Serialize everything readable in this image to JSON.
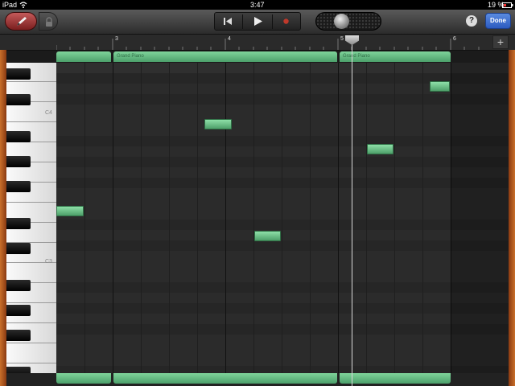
{
  "status_bar": {
    "device": "iPad",
    "time": "3:47",
    "battery": "19 %"
  },
  "toolbar": {
    "help_label": "?",
    "done_label": "Done",
    "record_color": "#c0392b"
  },
  "ruler": {
    "bars": [
      "3",
      "4",
      "5",
      "6"
    ],
    "add_label": "+"
  },
  "regions": [
    {
      "label": ""
    },
    {
      "label": "Grand Piano"
    },
    {
      "label": "Grand Piano"
    }
  ],
  "keyboard": {
    "labels": [
      "C4",
      "C3"
    ]
  },
  "icons": [
    "pencil-icon",
    "lock-icon",
    "rewind-icon",
    "play-icon",
    "record-icon",
    "wifi-icon",
    "battery-icon",
    "plus-icon"
  ],
  "colors": {
    "region_green": "#6cc38a",
    "wood": "#c9702a",
    "done_blue": "#3a6fd0"
  }
}
